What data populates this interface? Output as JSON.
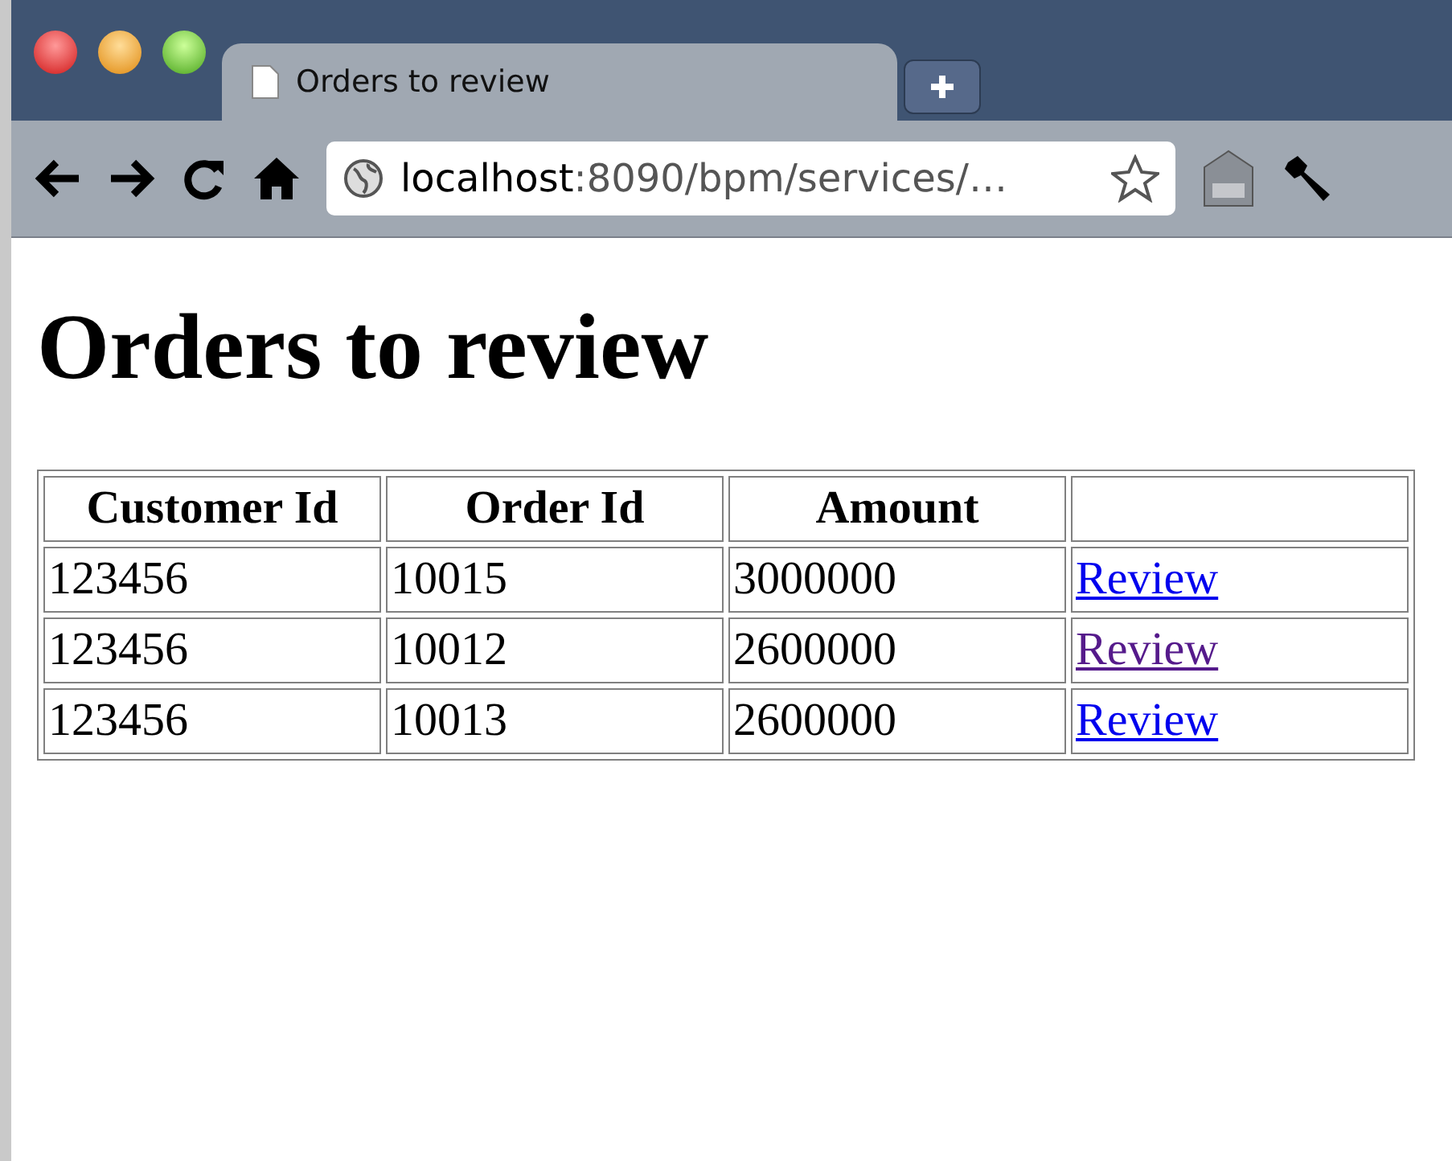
{
  "tab": {
    "title": "Orders to review"
  },
  "address_bar": {
    "host": "localhost",
    "path": ":8090/bpm/services/…"
  },
  "page": {
    "heading": "Orders to review",
    "table": {
      "columns": [
        "Customer Id",
        "Order Id",
        "Amount"
      ],
      "rows": [
        {
          "customer_id": "123456",
          "order_id": "10015",
          "amount": "3000000",
          "link": "Review",
          "visited": false
        },
        {
          "customer_id": "123456",
          "order_id": "10012",
          "amount": "2600000",
          "link": "Review",
          "visited": true
        },
        {
          "customer_id": "123456",
          "order_id": "10013",
          "amount": "2600000",
          "link": "Review",
          "visited": false
        }
      ]
    }
  }
}
